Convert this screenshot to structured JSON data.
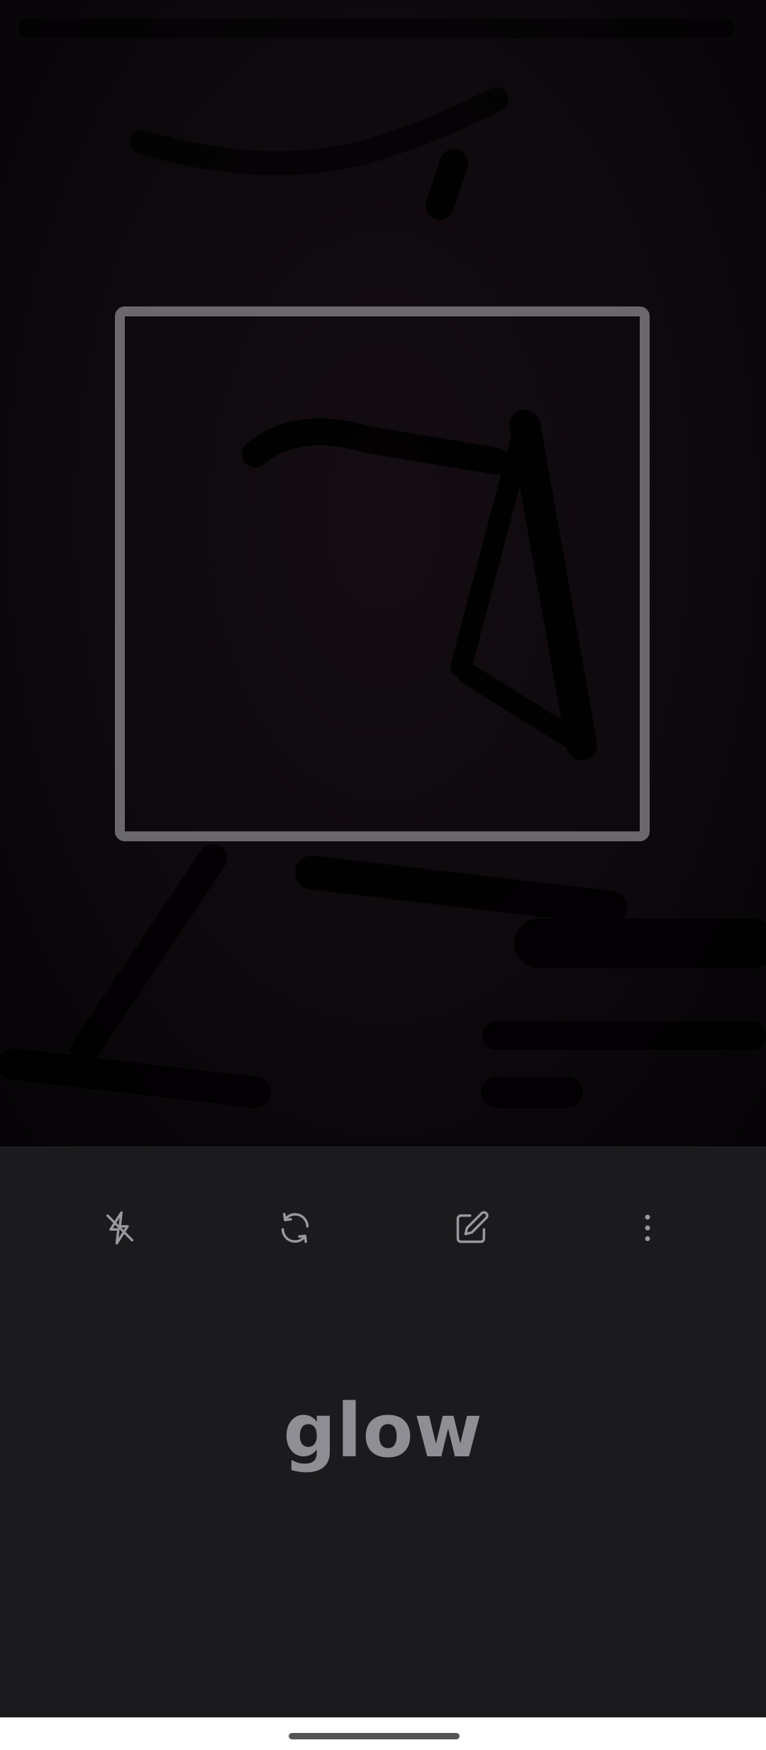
{
  "camera": {
    "scan_frame": "square-scan-frame"
  },
  "toolbar": {
    "flash": {
      "icon": "flash-off-icon"
    },
    "switch_camera": {
      "icon": "switch-camera-icon"
    },
    "edit": {
      "icon": "edit-pencil-icon"
    },
    "more": {
      "icon": "more-vertical-icon"
    }
  },
  "result": {
    "word": "glow"
  },
  "colors": {
    "panel_background": "#1b1b1d",
    "frame_color": "#6a686d",
    "word_color": "#8f8e94",
    "icon_color": "#9a999e"
  }
}
